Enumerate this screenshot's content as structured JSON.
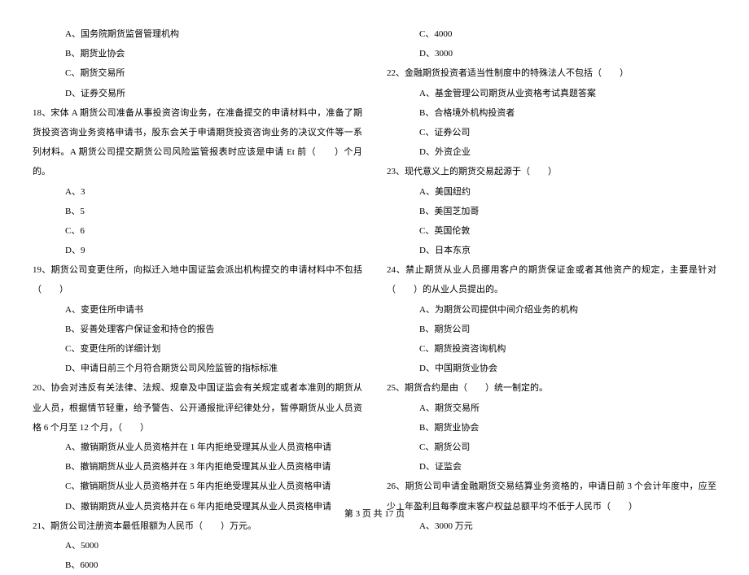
{
  "left": {
    "q17_opts": {
      "a": "A、国务院期货监督管理机构",
      "b": "B、期货业协会",
      "c": "C、期货交易所",
      "d": "D、证券交易所"
    },
    "q18": "18、宋体 A 期货公司准备从事投资咨询业务，在准备提交的申请材料中，准备了期货投资咨询业务资格申请书，股东会关于申请期货投资咨询业务的决议文件等一系列材料。A 期货公司提交期货公司风险监管报表时应该是申请 Et 前（　　）个月的。",
    "q18_opts": {
      "a": "A、3",
      "b": "B、5",
      "c": "C、6",
      "d": "D、9"
    },
    "q19": "19、期货公司变更住所，向拟迁入地中国证监会派出机构提交的申请材料中不包括（　　）",
    "q19_opts": {
      "a": "A、变更住所申请书",
      "b": "B、妥善处理客户保证金和持仓的报告",
      "c": "C、变更住所的详细计划",
      "d": "D、申请日前三个月符合期货公司风险监管的指标标准"
    },
    "q20": "20、协会对违反有关法律、法规、规章及中国证监会有关规定或者本准则的期货从业人员，根据情节轻重，给予警告、公开通报批评纪律处分，暂停期货从业人员资格 6 个月至 12 个月，（　　）",
    "q20_opts": {
      "a": "A、撤销期货从业人员资格并在 1 年内拒绝受理其从业人员资格申请",
      "b": "B、撤销期货从业人员资格并在 3 年内拒绝受理其从业人员资格申请",
      "c": "C、撤销期货从业人员资格并在 5 年内拒绝受理其从业人员资格申请",
      "d": "D、撤销期货从业人员资格并在 6 年内拒绝受理其从业人员资格申请"
    },
    "q21": "21、期货公司注册资本最低限额为人民币（　　）万元。",
    "q21_opts": {
      "a": "A、5000",
      "b": "B、6000"
    }
  },
  "right": {
    "q21_opts": {
      "c": "C、4000",
      "d": "D、3000"
    },
    "q22": "22、金融期货投资者适当性制度中的特殊法人不包括（　　）",
    "q22_opts": {
      "a": "A、基金管理公司期货从业资格考试真题答案",
      "b": "B、合格境外机构投资者",
      "c": "C、证券公司",
      "d": "D、外资企业"
    },
    "q23": "23、现代意义上的期货交易起源于（　　）",
    "q23_opts": {
      "a": "A、美国纽约",
      "b": "B、美国芝加哥",
      "c": "C、英国伦敦",
      "d": "D、日本东京"
    },
    "q24": "24、禁止期货从业人员挪用客户的期货保证金或者其他资产的规定，主要是针对（　　）的从业人员提出的。",
    "q24_opts": {
      "a": "A、为期货公司提供中间介绍业务的机构",
      "b": "B、期货公司",
      "c": "C、期货投资咨询机构",
      "d": "D、中国期货业协会"
    },
    "q25": "25、期货合约是由（　　）统一制定的。",
    "q25_opts": {
      "a": "A、期货交易所",
      "b": "B、期货业协会",
      "c": "C、期货公司",
      "d": "D、证监会"
    },
    "q26": "26、期货公司申请金融期货交易结算业务资格的，申请日前 3 个会计年度中，应至少 1 年盈利且每季度末客户权益总额平均不低于人民币（　　）",
    "q26_opts": {
      "a": "A、3000 万元"
    }
  },
  "footer": "第 3 页 共 17 页"
}
